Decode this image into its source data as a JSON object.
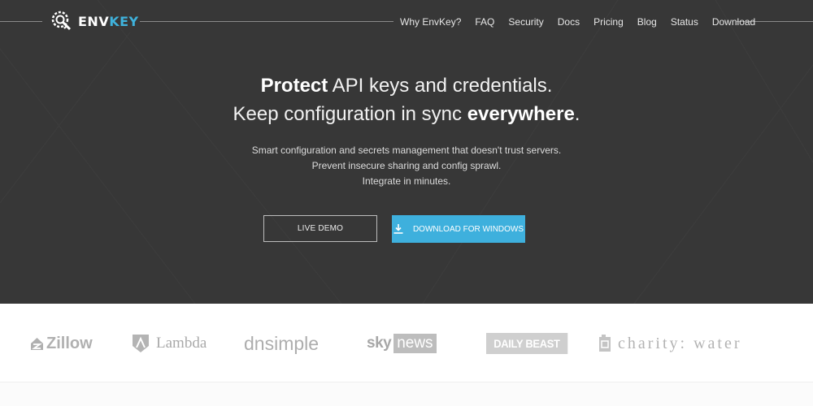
{
  "brand": {
    "name_part1": "ENV",
    "name_part2": "KEY",
    "accent_color": "#3fb2dc"
  },
  "nav": {
    "items": [
      {
        "label": "Why EnvKey?"
      },
      {
        "label": "FAQ"
      },
      {
        "label": "Security"
      },
      {
        "label": "Docs"
      },
      {
        "label": "Pricing"
      },
      {
        "label": "Blog"
      },
      {
        "label": "Status"
      },
      {
        "label": "Download"
      }
    ]
  },
  "hero": {
    "line1_bold": "Protect",
    "line1_rest": " API keys and credentials.",
    "line2_start": "Keep configuration in sync ",
    "line2_bold": "everywhere",
    "line2_end": ".",
    "sub1": "Smart configuration and secrets management that doesn't trust servers.",
    "sub2": "Prevent insecure sharing and config sprawl.",
    "sub3": "Integrate in minutes.",
    "background_color": "#373737"
  },
  "buttons": {
    "demo_label": "LIVE DEMO",
    "download_label": "DOWNLOAD FOR WINDOWS",
    "download_icon": "download-icon",
    "download_color": "#3eb0dd"
  },
  "clients": {
    "zillow": "Zillow",
    "lambda": "Lambda",
    "dnsimple": "dnsimple",
    "sky": "sky",
    "news": "news",
    "dailybeast": "DAILY BEAST",
    "charity": "charity: water"
  }
}
